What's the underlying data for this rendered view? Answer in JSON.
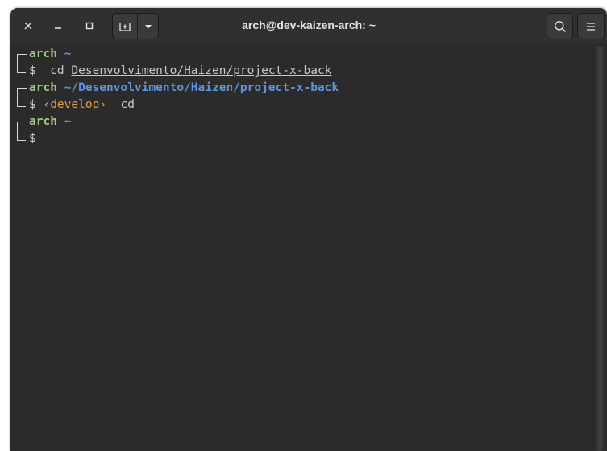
{
  "window": {
    "title": "arch@dev-kaizen-arch: ~"
  },
  "prompt": {
    "user": "arch",
    "dollar": "$"
  },
  "lines": [
    {
      "cwd": "~",
      "branch": "",
      "command": "cd",
      "argument": "Desenvolvimento/Haizen/project-x-back"
    },
    {
      "cwd": "~/Desenvolvimento/Haizen/project-x-back",
      "branch": "‹develop›",
      "command": "cd",
      "argument": ""
    },
    {
      "cwd": "~",
      "branch": "",
      "command": "",
      "argument": ""
    }
  ],
  "icons": {
    "close": "close-icon",
    "minimize": "minimize-icon",
    "maximize": "maximize-icon",
    "new_tab": "new-tab-icon",
    "dropdown": "chevron-down-icon",
    "search": "search-icon",
    "menu": "hamburger-menu-icon"
  },
  "colors": {
    "background": "#2b2b2b",
    "user": "#a5c882",
    "path": "#5f95d8",
    "branch": "#e79a45"
  }
}
